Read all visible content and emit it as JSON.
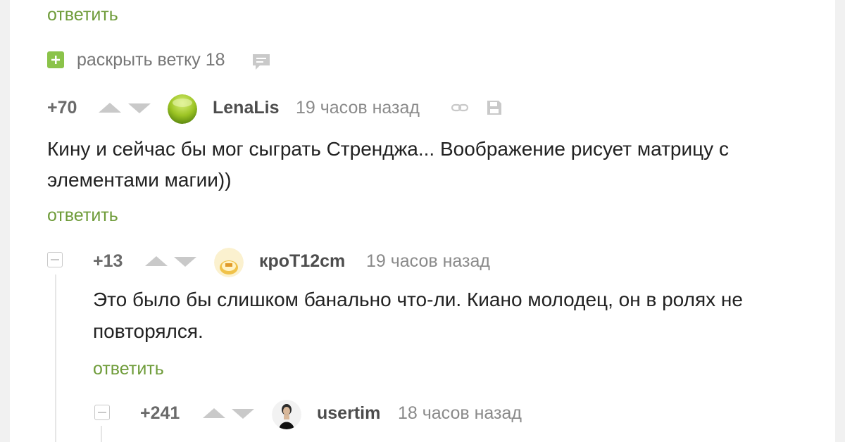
{
  "top_reply_label": "ответить",
  "expand_thread": {
    "label": "раскрыть ветку 18",
    "icon": "plus-icon",
    "comment_icon": "comment-icon"
  },
  "comments": [
    {
      "rating": "+70",
      "username": "LenaLis",
      "time": "19 часов назад",
      "text_line1": "Кину и сейчас бы мог сыграть Стренджа... Воображение рисует матрицу с",
      "text_line2": "элементами магии))",
      "reply_label": "ответить",
      "icons": [
        "link-icon",
        "save-icon"
      ]
    },
    {
      "rating": "+13",
      "username": "кроТ12cm",
      "time": "19 часов назад",
      "text_line1": "Это было бы слишком банально что-ли.  Киано молодец, он в ролях не",
      "text_line2": "повторялся.",
      "reply_label": "ответить"
    },
    {
      "rating": "+241",
      "username": "usertim",
      "time": "18 часов назад"
    }
  ],
  "colors": {
    "accent_green": "#6f9c3a",
    "plus_box": "#8bc34a",
    "vote_arrow": "#c9c9c9",
    "background": "#f1f1f1"
  }
}
